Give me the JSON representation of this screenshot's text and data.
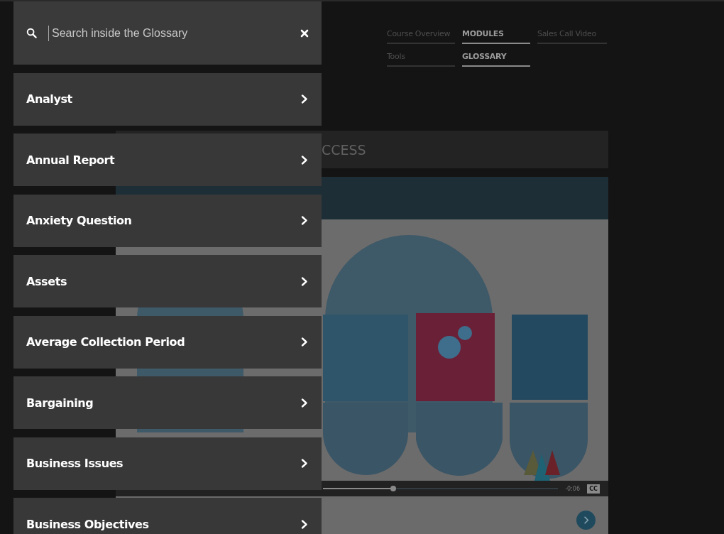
{
  "nav": [
    {
      "label": "Course Overview",
      "selected": false
    },
    {
      "label": "MODULES",
      "selected": true
    },
    {
      "label": "Sales Call Video",
      "selected": false
    },
    {
      "label": "Tools",
      "selected": false
    },
    {
      "label": "GLOSSARY",
      "selected": true
    }
  ],
  "module_title": "CCESS",
  "video": {
    "kind": "picture",
    "progress": {
      "level": 0.3
    },
    "time": "-0:06",
    "captions": "CC"
  },
  "glossary": {
    "search": {
      "placeholder": "Search inside the Glossary"
    },
    "items": [
      {
        "label": "Analyst"
      },
      {
        "label": "Annual Report"
      },
      {
        "label": "Anxiety Question"
      },
      {
        "label": "Assets"
      },
      {
        "label": "Average Collection Period"
      },
      {
        "label": "Bargaining"
      },
      {
        "label": "Business Issues"
      },
      {
        "label": "Business Objectives"
      }
    ]
  }
}
